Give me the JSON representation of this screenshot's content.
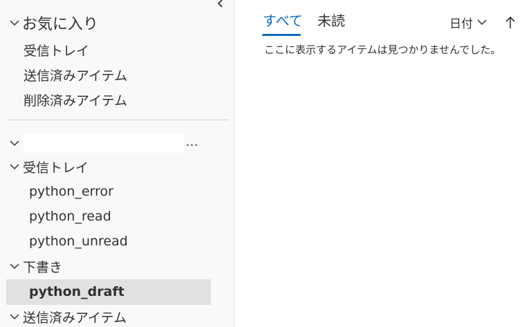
{
  "sidebar": {
    "collapse_icon": "chevron-left-icon",
    "favorites": {
      "title": "お気に入り",
      "items": [
        "受信トレイ",
        "送信済みアイテム",
        "削除済みアイテム"
      ]
    },
    "account": {
      "more_label": "…",
      "folders": [
        {
          "label": "受信トレイ",
          "expanded": true
        },
        {
          "label": "python_error"
        },
        {
          "label": "python_read"
        },
        {
          "label": "python_unread"
        },
        {
          "label": "下書き",
          "expanded": true
        },
        {
          "label": "python_draft",
          "selected": true
        },
        {
          "label": "送信済みアイテム",
          "expanded": true
        }
      ]
    }
  },
  "main": {
    "tabs": [
      {
        "label": "すべて",
        "active": true
      },
      {
        "label": "未読",
        "active": false
      }
    ],
    "sort": {
      "label": "日付",
      "direction_icon": "arrow-up-icon"
    },
    "empty_message": "ここに表示するアイテムは見つかりませんでした。"
  },
  "colors": {
    "accent": "#0f6cbd",
    "sidebar_bg": "#faf9f8",
    "selected_bg": "#e1e1e1"
  }
}
